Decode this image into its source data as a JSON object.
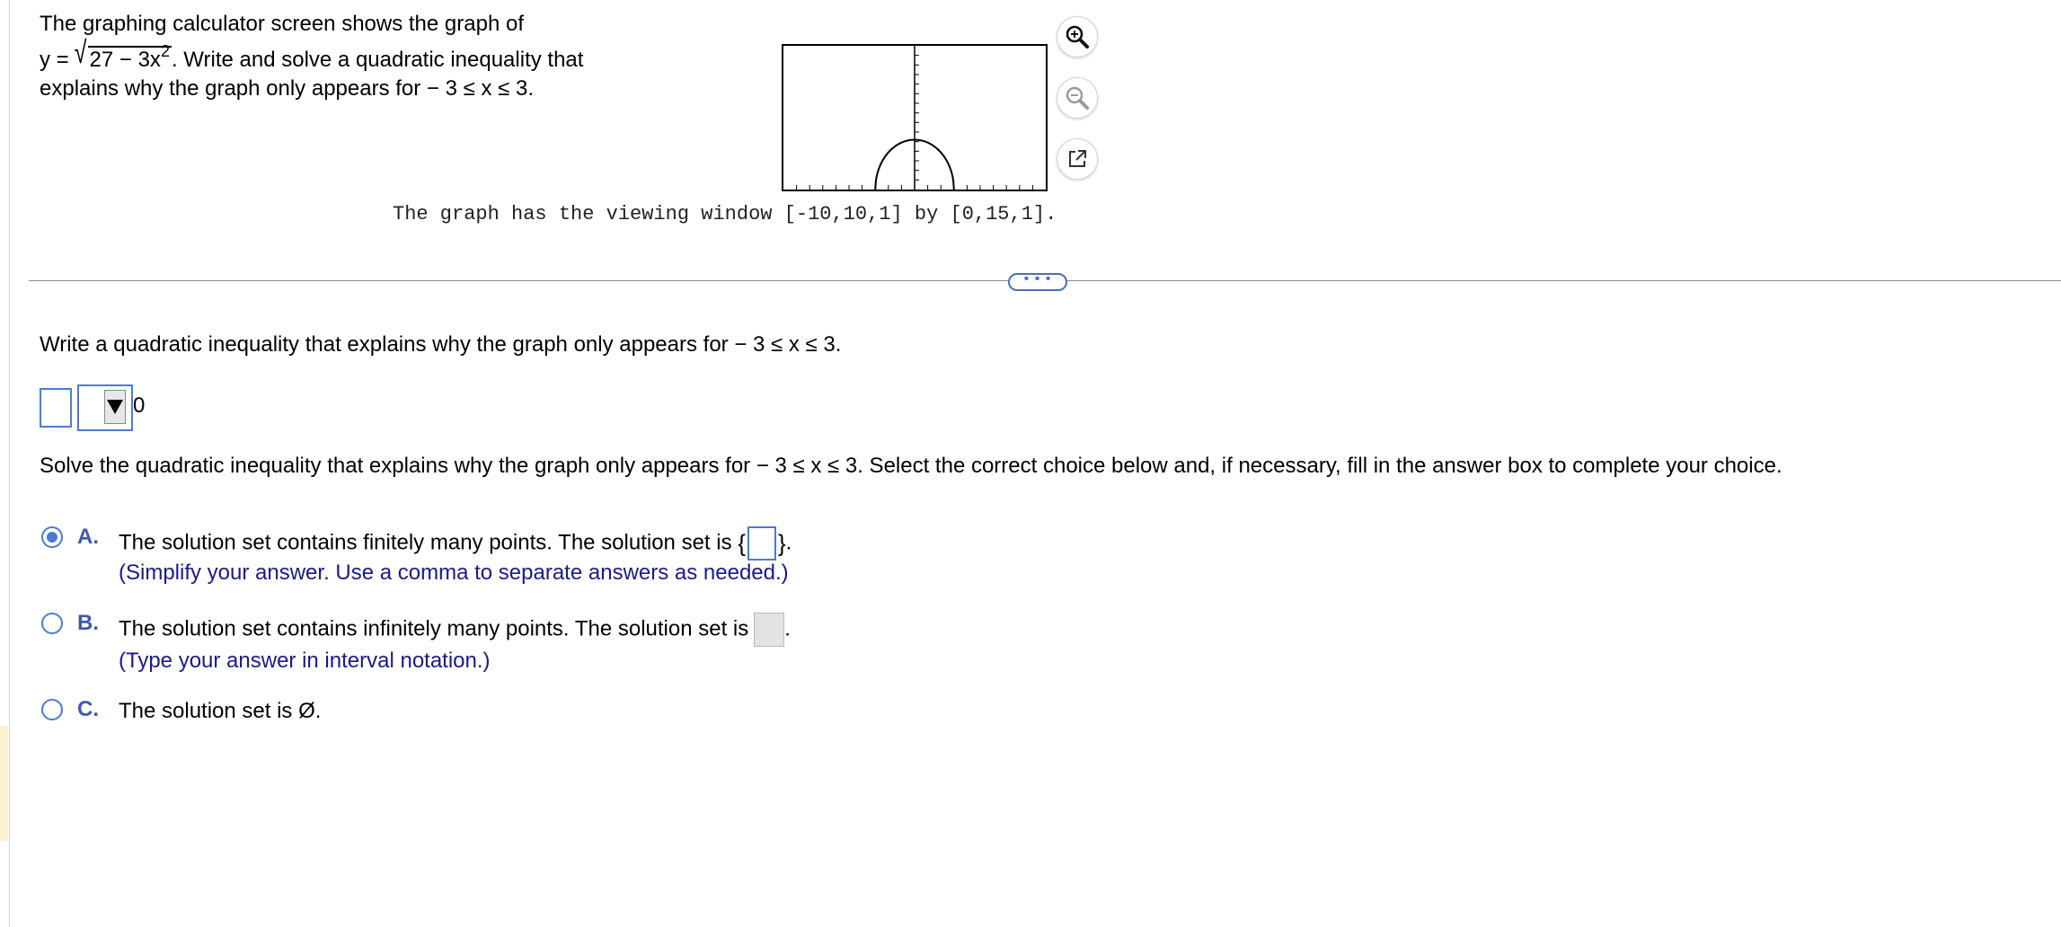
{
  "problem": {
    "line1": "The graphing calculator screen shows the graph of",
    "eq_prefix": "y = ",
    "radicand": "27 − 3x",
    "exponent": "2",
    "eq_suffix": ". Write and solve a quadratic inequality that",
    "line3": "explains why the graph only appears for  − 3 ≤ x ≤ 3."
  },
  "graph": {
    "caption": "The graph has the viewing window [-10,10,1] by [0,15,1].",
    "window": {
      "xmin": -10,
      "xmax": 10,
      "xscl": 1,
      "ymin": 0,
      "ymax": 15,
      "yscl": 1
    },
    "function": "y = sqrt(27 - 3x^2)",
    "domain": [
      -3,
      3
    ]
  },
  "tools": {
    "zoom_in": "zoom-in-icon",
    "zoom_out": "zoom-out-icon",
    "popout": "popout-icon"
  },
  "divider": {
    "more_label": "• • •"
  },
  "question1": {
    "prompt": "Write a quadratic inequality that explains why the graph only appears for  − 3 ≤ x ≤ 3.",
    "rhs": "0"
  },
  "question2": {
    "prompt": "Solve the quadratic inequality that explains why the graph only appears for  − 3 ≤ x ≤ 3. Select the correct choice below and, if necessary, fill in the answer box to complete your choice."
  },
  "choices": [
    {
      "letter": "A.",
      "text": "The solution set contains finitely many points. The solution set is ",
      "open_brace": "{",
      "close_brace": "}",
      "end": ".",
      "hint": "(Simplify your answer. Use a comma to separate answers as needed.)",
      "selected": true
    },
    {
      "letter": "B.",
      "text": "The solution set contains infinitely many points. The solution set is",
      "end": ".",
      "hint": "(Type your answer in interval notation.)",
      "selected": false
    },
    {
      "letter": "C.",
      "text": "The solution set is Ø.",
      "selected": false
    }
  ],
  "colors": {
    "accent": "#4a7bd4",
    "choice_letter": "#4159a8",
    "hint_text": "#1a1a8c"
  }
}
